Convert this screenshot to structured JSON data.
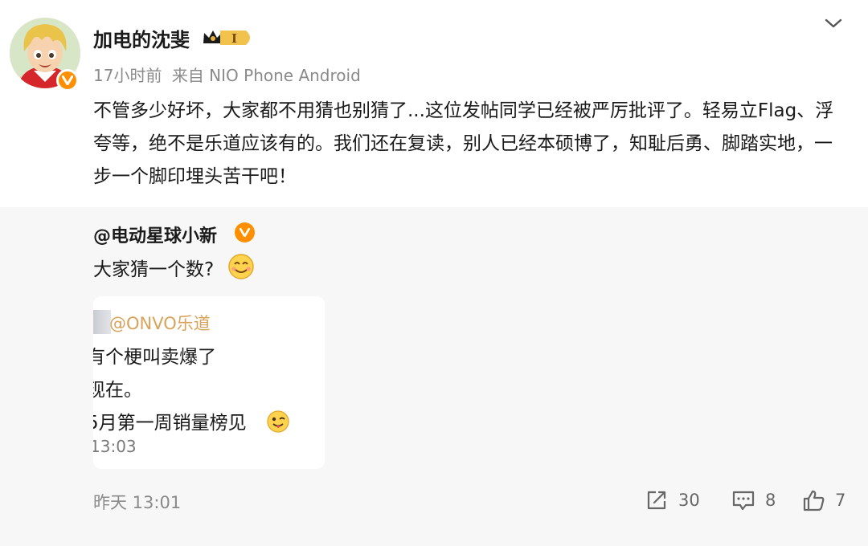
{
  "post": {
    "username": "加电的沈斐",
    "vip_badge_text": "I",
    "time": "17小时前",
    "source": "来自 NIO Phone Android",
    "text": "不管多少好坏，大家都不用猜也别猜了...这位发帖同学已经被严厉批评了。轻易立Flag、浮夸等，绝不是乐道应该有的。我们还在复读，别人已经本硕博了，知耻后勇、脚踏实地，一步一个脚印埋头苦干吧！"
  },
  "repost": {
    "username": "@电动星球小新",
    "text": "大家猜一个数?",
    "image": {
      "handle": "@ONVO乐道",
      "lines": [
        "有个梗叫卖爆了",
        "现在。",
        "5月第一周销量榜见"
      ],
      "time": "13:03"
    },
    "footer_time": "昨天 13:01",
    "actions": {
      "repost_count": "30",
      "comment_count": "8",
      "like_count": "7"
    }
  },
  "icons": {
    "dropdown": "chevron-down-icon",
    "verified": "verified-v-icon",
    "vip": "crown-badge-icon",
    "repost": "share-arrow-icon",
    "comment": "comment-icon",
    "like": "thumbs-up-icon",
    "smile_emoji": "smile-emoji-icon",
    "wink_emoji": "wink-tongue-emoji-icon"
  },
  "colors": {
    "verified": "#ff8f00",
    "vip_gold": "#e8b33c",
    "handle": "#d9a25a",
    "repost_bg": "#f7f7f7",
    "meta_text": "#8a8a8a"
  }
}
